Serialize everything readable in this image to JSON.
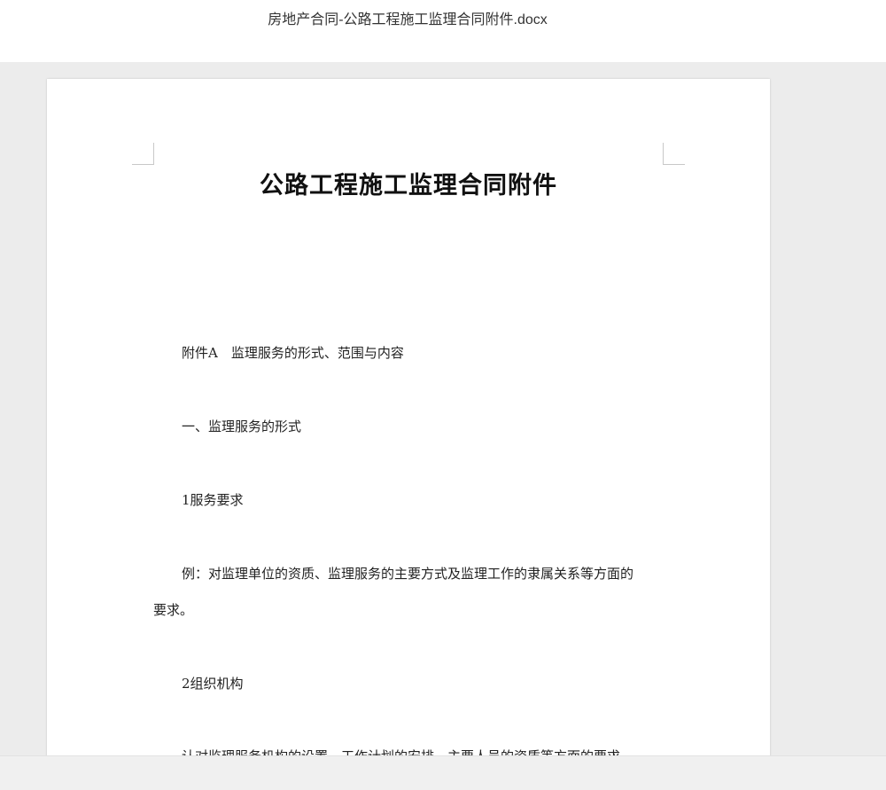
{
  "window": {
    "file_title": "房地产合同-公路工程施工监理合同附件.docx"
  },
  "document": {
    "title": "公路工程施工监理合同附件",
    "paragraphs": [
      "附件A　监理服务的形式、范围与内容",
      "一、监理服务的形式",
      "1服务要求",
      "例：对监理单位的资质、监理服务的主要方式及监理工作的隶属关系等方面的",
      "要求。",
      "2组织机构",
      "认对监理服务机构的设置、工作计划的安排、主要人员的资质等方面的要求"
    ]
  }
}
